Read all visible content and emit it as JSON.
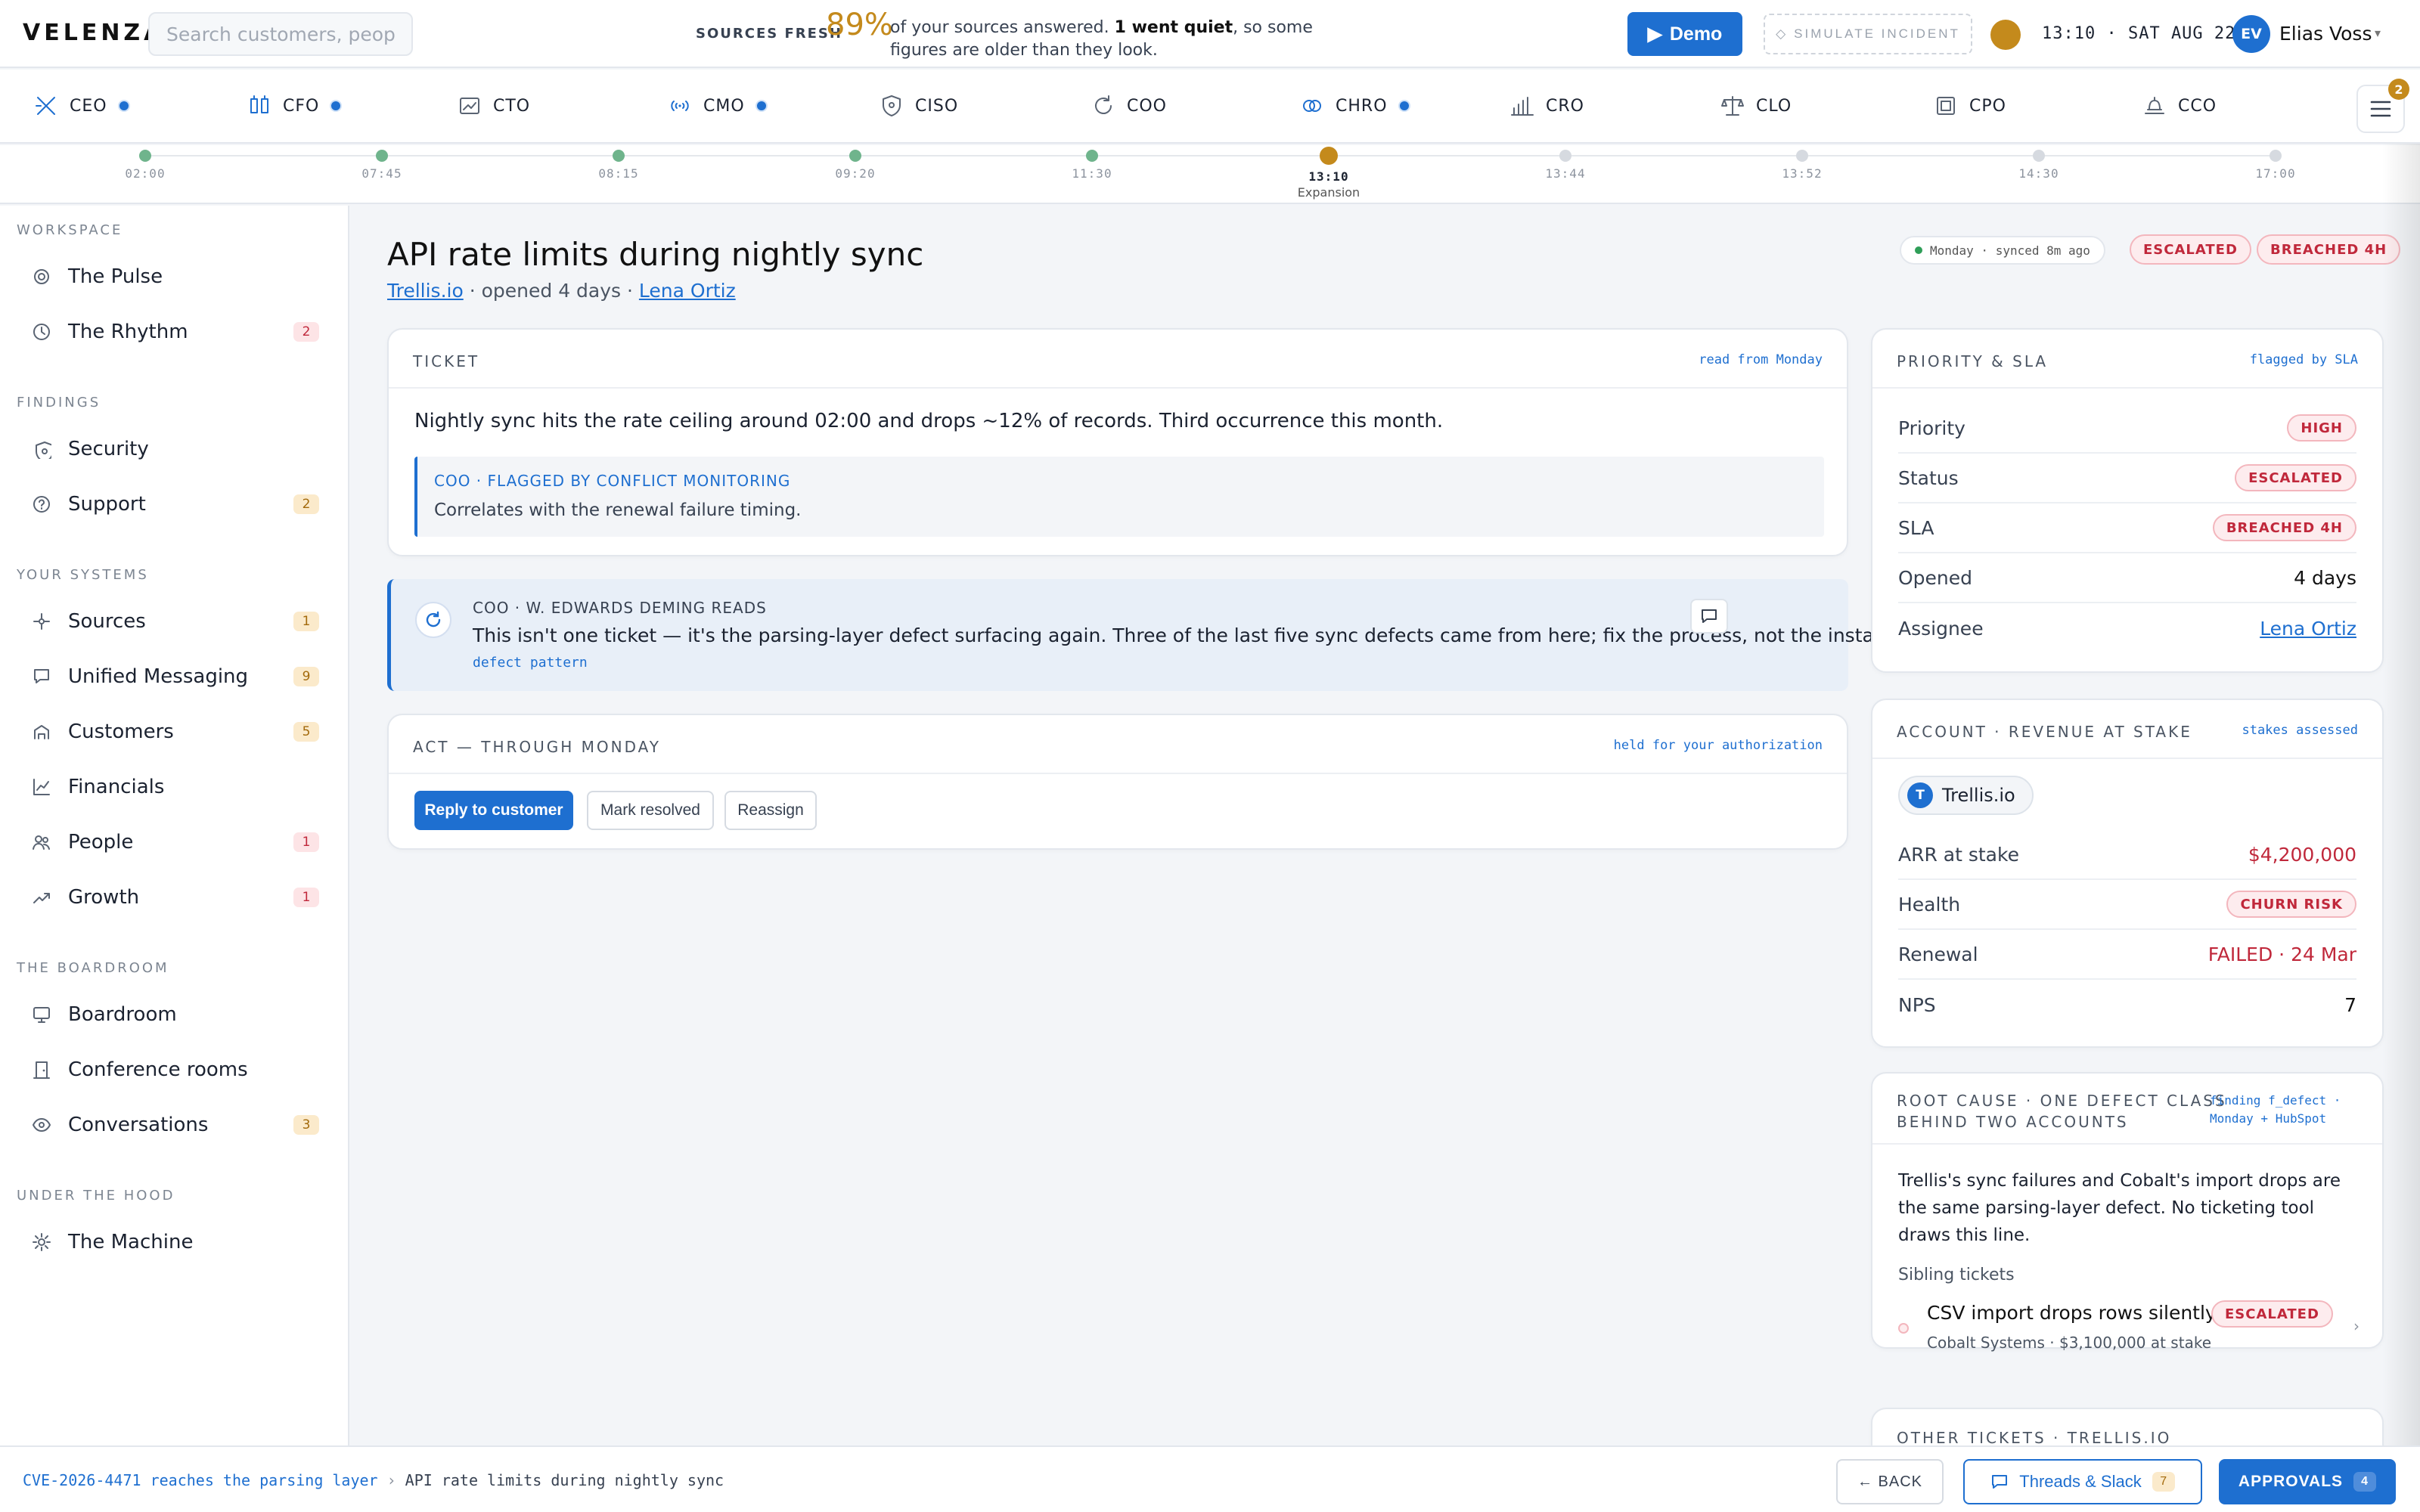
{
  "header": {
    "logo": "VELENZA.",
    "search_placeholder": "Search customers, people, ti",
    "fresh_label": "SOURCES FRESH",
    "fresh_pct": "89%",
    "fresh_msg_a": "of your sources answered. ",
    "fresh_msg_b": "1 went quiet",
    "fresh_msg_c": ", so some figures are older than they look.",
    "demo_label": "Demo",
    "simulate_label": "SIMULATE INCIDENT",
    "clock": "13:10 · SAT AUG 22",
    "user_initials": "EV",
    "user_name": "Elias Voss"
  },
  "roles": [
    {
      "label": "CEO",
      "icon": "ceo-icon",
      "dot": true
    },
    {
      "label": "CFO",
      "icon": "cfo-icon",
      "dot": true
    },
    {
      "label": "CTO",
      "icon": "cto-icon",
      "dot": false
    },
    {
      "label": "CMO",
      "icon": "cmo-icon",
      "dot": true
    },
    {
      "label": "CISO",
      "icon": "shield-icon",
      "dot": false
    },
    {
      "label": "COO",
      "icon": "cycle-icon",
      "dot": false
    },
    {
      "label": "CHRO",
      "icon": "rings-icon",
      "dot": true
    },
    {
      "label": "CRO",
      "icon": "bar-chart-icon",
      "dot": false
    },
    {
      "label": "CLO",
      "icon": "scales-icon",
      "dot": false
    },
    {
      "label": "CPO",
      "icon": "square-icon",
      "dot": false
    },
    {
      "label": "CCO",
      "icon": "bell-icon",
      "dot": false
    }
  ],
  "menu_badge": "2",
  "timeline": [
    {
      "time": "02:00",
      "state": "done",
      "label": ""
    },
    {
      "time": "07:45",
      "state": "done",
      "label": ""
    },
    {
      "time": "08:15",
      "state": "done",
      "label": ""
    },
    {
      "time": "09:20",
      "state": "done",
      "label": ""
    },
    {
      "time": "11:30",
      "state": "done",
      "label": ""
    },
    {
      "time": "13:10",
      "state": "current",
      "label": "Expansion"
    },
    {
      "time": "13:44",
      "state": "future",
      "label": ""
    },
    {
      "time": "13:52",
      "state": "future",
      "label": ""
    },
    {
      "time": "14:30",
      "state": "future",
      "label": ""
    },
    {
      "time": "17:00",
      "state": "future",
      "label": ""
    }
  ],
  "sidebar": {
    "sections": [
      {
        "title": "WORKSPACE",
        "items": [
          {
            "label": "The Pulse",
            "icon": "pulse-icon",
            "count": "",
            "tone": ""
          },
          {
            "label": "The Rhythm",
            "icon": "clock-icon",
            "count": "2",
            "tone": "red"
          }
        ]
      },
      {
        "title": "FINDINGS",
        "items": [
          {
            "label": "Security",
            "icon": "shield-icon",
            "count": "",
            "tone": ""
          },
          {
            "label": "Support",
            "icon": "help-circle-icon",
            "count": "2",
            "tone": "amb"
          }
        ]
      },
      {
        "title": "YOUR SYSTEMS",
        "items": [
          {
            "label": "Sources",
            "icon": "sources-icon",
            "count": "1",
            "tone": "amb"
          },
          {
            "label": "Unified Messaging",
            "icon": "message-icon",
            "count": "9",
            "tone": "amb"
          },
          {
            "label": "Customers",
            "icon": "building-icon",
            "count": "5",
            "tone": "amb"
          },
          {
            "label": "Financials",
            "icon": "line-chart-icon",
            "count": "",
            "tone": ""
          },
          {
            "label": "People",
            "icon": "people-icon",
            "count": "1",
            "tone": "red"
          },
          {
            "label": "Growth",
            "icon": "trend-up-icon",
            "count": "1",
            "tone": "red"
          }
        ]
      },
      {
        "title": "THE BOARDROOM",
        "items": [
          {
            "label": "Boardroom",
            "icon": "monitor-icon",
            "count": "",
            "tone": ""
          },
          {
            "label": "Conference rooms",
            "icon": "door-icon",
            "count": "",
            "tone": ""
          },
          {
            "label": "Conversations",
            "icon": "eye-icon",
            "count": "3",
            "tone": "amb"
          }
        ]
      },
      {
        "title": "UNDER THE HOOD",
        "items": [
          {
            "label": "The Machine",
            "icon": "cog-icon",
            "count": "",
            "tone": ""
          }
        ]
      }
    ]
  },
  "main": {
    "title": "API rate limits during nightly sync",
    "account_link": "Trellis.io",
    "opened_text": " · opened 4 days · ",
    "owner_link": "Lena Ortiz",
    "synced": "Monday · synced 8m ago",
    "badge_escalated": "ESCALATED",
    "badge_breached": "BREACHED 4H"
  },
  "ticket": {
    "header": "TICKET",
    "meta": "read from Monday",
    "body": "Nightly sync hits the rate ceiling around 02:00 and drops ~12% of records. Third occurrence this month.",
    "flag_title": "COO · FLAGGED BY CONFLICT MONITORING",
    "flag_body": "Correlates with the renewal failure timing."
  },
  "insight": {
    "header": "COO · W. EDWARDS DEMING READS",
    "body": "This isn't one ticket — it's the parsing-layer defect surfacing again. Three of the last five sync defects came from here; fix the process, not the instance.",
    "tag": "defect pattern"
  },
  "act": {
    "header": "ACT — THROUGH MONDAY",
    "meta": "held for your authorization",
    "primary": "Reply to customer",
    "secondary1": "Mark resolved",
    "secondary2": "Reassign"
  },
  "priority": {
    "header": "PRIORITY & SLA",
    "meta": "flagged by SLA",
    "rows": [
      {
        "label": "Priority",
        "value": "HIGH",
        "kind": "pill"
      },
      {
        "label": "Status",
        "value": "ESCALATED",
        "kind": "pill"
      },
      {
        "label": "SLA",
        "value": "BREACHED 4H",
        "kind": "pill"
      },
      {
        "label": "Opened",
        "value": "4 days",
        "kind": "text"
      },
      {
        "label": "Assignee",
        "value": "Lena Ortiz",
        "kind": "link"
      }
    ]
  },
  "account": {
    "header": "ACCOUNT · REVENUE AT STAKE",
    "meta": "stakes assessed",
    "chip_initial": "T",
    "chip_name": "Trellis.io",
    "rows": [
      {
        "label": "ARR at stake",
        "value": "$4,200,000",
        "kind": "red"
      },
      {
        "label": "Health",
        "value": "CHURN RISK",
        "kind": "pill"
      },
      {
        "label": "Renewal",
        "value": "FAILED · 24 Mar",
        "kind": "red"
      },
      {
        "label": "NPS",
        "value": "7",
        "kind": "text"
      }
    ]
  },
  "root": {
    "header1": "ROOT CAUSE · ONE DEFECT CLASS",
    "header2": "BEHIND TWO ACCOUNTS",
    "meta1": "finding f_defect ·",
    "meta2": "Monday + HubSpot",
    "body": "Trellis's sync failures and Cobalt's import drops are the same parsing-layer defect. No ticketing tool draws this line.",
    "sibling_label": "Sibling tickets",
    "sibling_title": "CSV import drops rows silently",
    "sibling_badge": "ESCALATED",
    "sibling_sub": "Cobalt Systems · $3,100,000 at stake"
  },
  "other": {
    "header": "OTHER TICKETS · TRELLIS.IO"
  },
  "footer": {
    "crumb_link": "CVE-2026-4471 reaches the parsing layer",
    "crumb_sep": "›",
    "crumb_current": "API rate limits during nightly sync",
    "back": "← BACK",
    "threads": "Threads & Slack",
    "threads_count": "7",
    "approvals": "APPROVALS",
    "approvals_count": "4"
  },
  "colors": {
    "accent": "#1e6fd0",
    "warning": "#c48a1c",
    "danger": "#c0283b",
    "ok": "#2f9e58"
  }
}
